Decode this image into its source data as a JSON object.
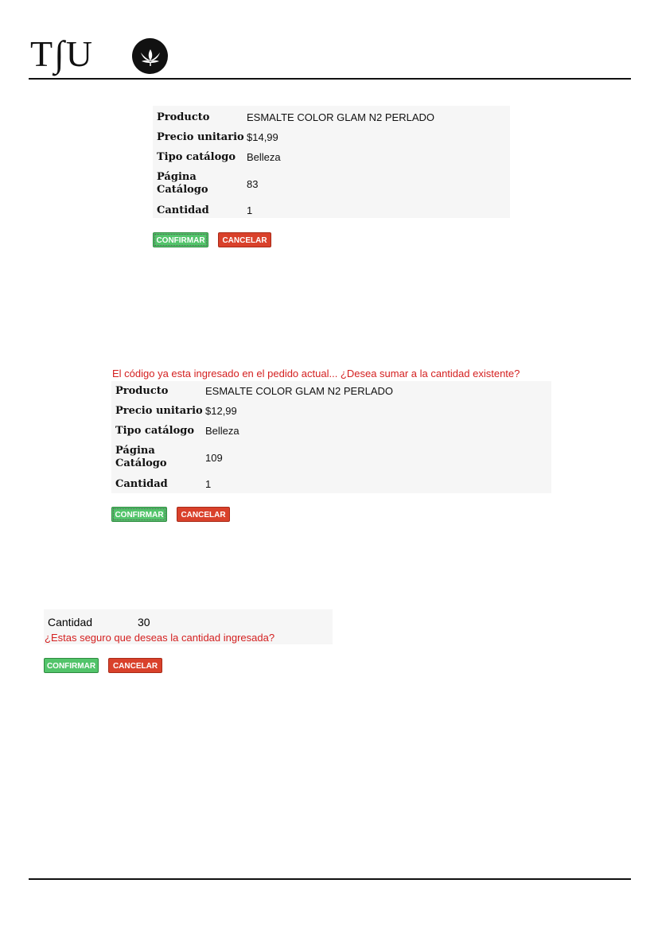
{
  "brand": {
    "logo_text": "T∫U",
    "emblem_icon": "lotus-flower-icon"
  },
  "colors": {
    "confirm": "#52c46a",
    "cancel": "#d9412b",
    "warning": "#d42020",
    "panel": "#f6f6f6"
  },
  "panel1": {
    "rows": [
      {
        "label": "Producto",
        "value": "ESMALTE COLOR GLAM N2 PERLADO"
      },
      {
        "label": "Precio unitario",
        "value": "$14,99"
      },
      {
        "label": "Tipo catálogo",
        "value": "Belleza"
      },
      {
        "label": "Página Catálogo",
        "value": "83"
      },
      {
        "label": "Cantidad",
        "value": "1"
      }
    ],
    "confirm_label": "CONFIRMAR",
    "cancel_label": "CANCELAR"
  },
  "panel2": {
    "warning": "El código ya esta ingresado en el pedido actual... ¿Desea sumar a la cantidad existente?",
    "rows": [
      {
        "label": "Producto",
        "value": "ESMALTE COLOR GLAM N2 PERLADO"
      },
      {
        "label": "Precio unitario",
        "value": "$12,99"
      },
      {
        "label": "Tipo catálogo",
        "value": "Belleza"
      },
      {
        "label": "Página Catálogo",
        "value": "109"
      },
      {
        "label": "Cantidad",
        "value": "1"
      }
    ],
    "confirm_label": "CONFIRMAR",
    "cancel_label": "CANCELAR"
  },
  "panel3": {
    "label": "Cantidad",
    "value": "30",
    "warning": "¿Estas seguro que deseas la cantidad ingresada?",
    "confirm_label": "CONFIRMAR",
    "cancel_label": "CANCELAR"
  }
}
